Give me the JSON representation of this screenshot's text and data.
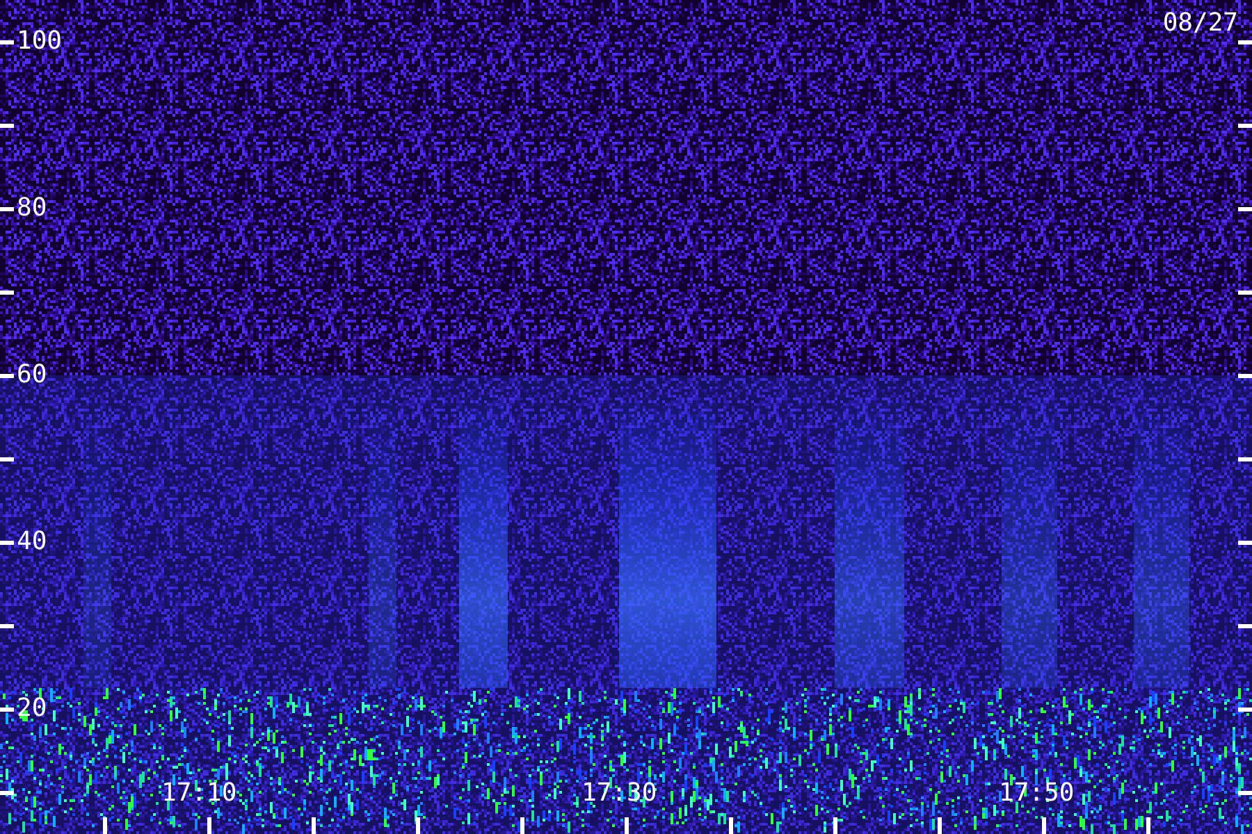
{
  "date": "08/27",
  "y_axis": {
    "labels": [
      "100",
      "80",
      "60",
      "40",
      "20"
    ]
  },
  "x_axis": {
    "labels": [
      "17:10",
      "17:30",
      "17:50"
    ]
  }
}
